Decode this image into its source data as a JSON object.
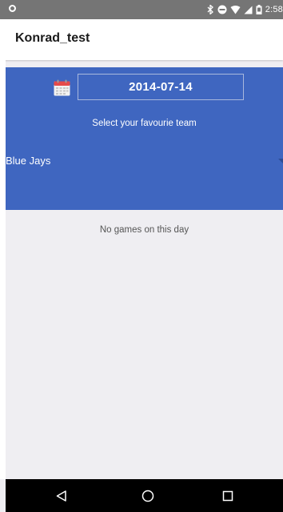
{
  "status_bar": {
    "time": "2:58",
    "icons": [
      "status-dot-icon",
      "bluetooth-icon",
      "do-not-disturb-icon",
      "wifi-icon",
      "signal-icon",
      "battery-icon"
    ]
  },
  "app_bar": {
    "title": "Konrad_test"
  },
  "panel": {
    "date": "2014-07-14",
    "select_label": "Select your favourie team",
    "team": "Blue Jays",
    "colors": {
      "panel_bg": "#3f66c0",
      "accent": "#2d4c95"
    }
  },
  "content": {
    "empty_message": "No games on this day"
  },
  "nav_bar": {
    "buttons": [
      "back-icon",
      "home-icon",
      "recents-icon"
    ]
  }
}
